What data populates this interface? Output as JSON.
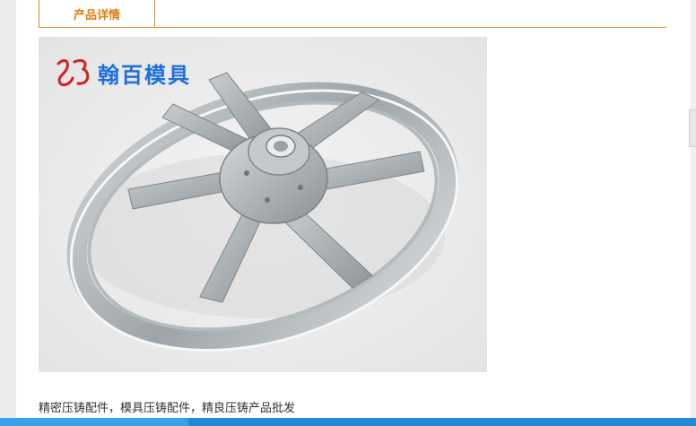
{
  "tabs": {
    "active_label": "产品详情"
  },
  "product_image": {
    "watermark_logo_text": "翰百模具",
    "alt": "Aluminum die-cast fan wheel"
  },
  "caption": "精密压铸配件，模具压铸配件，精良压铸产品批发",
  "colors": {
    "accent": "#e08a1e",
    "tab_text": "#e07d10",
    "watermark": "#1f6fe0",
    "bottom_bar": "#1e8ad8"
  }
}
